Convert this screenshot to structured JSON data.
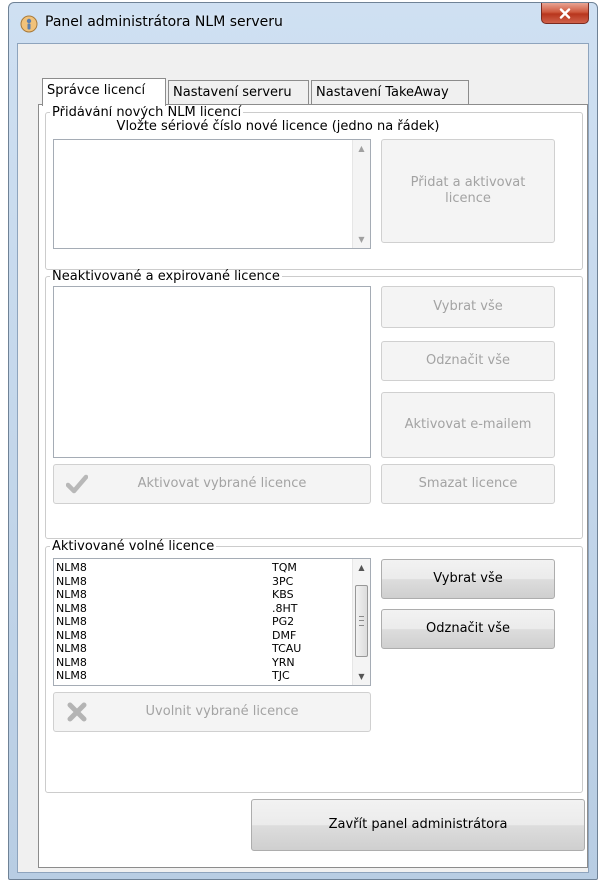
{
  "window": {
    "title": "Panel administrátora NLM serveru"
  },
  "tabs": [
    {
      "label": "Správce licencí"
    },
    {
      "label": "Nastavení serveru"
    },
    {
      "label": "Nastavení TakeAway"
    }
  ],
  "add_section": {
    "legend": "Přidávání nových NLM licencí",
    "hint": "Vložte sériové číslo nové licence (jedno na řádek)",
    "add_button": "Přidat a aktivovat licence"
  },
  "inactive_section": {
    "legend": "Neaktivované a expirované licence",
    "select_all": "Vybrat vše",
    "deselect_all": "Odznačit vše",
    "activate_email": "Aktivovat e-mailem",
    "activate_selected": "Aktivovat vybrané licence",
    "delete": "Smazat licence"
  },
  "active_section": {
    "legend": "Aktivované volné licence",
    "select_all": "Vybrat vše",
    "deselect_all": "Odznačit vše",
    "release_selected": "Uvolnit vybrané licence",
    "licenses": [
      {
        "prefix": "NLM8",
        "suffix": "TQM"
      },
      {
        "prefix": "NLM8",
        "suffix": "3PC"
      },
      {
        "prefix": "NLM8",
        "suffix": "KBS"
      },
      {
        "prefix": "NLM8",
        "suffix": ".8HT"
      },
      {
        "prefix": "NLM8",
        "suffix": "PG2"
      },
      {
        "prefix": "NLM8",
        "suffix": "DMF"
      },
      {
        "prefix": "NLM8",
        "suffix": "TCAU"
      },
      {
        "prefix": "NLM8",
        "suffix": "YRN"
      },
      {
        "prefix": "NLM8",
        "suffix": "TJC"
      }
    ]
  },
  "footer": {
    "close_button": "Zavřít panel administrátora"
  }
}
